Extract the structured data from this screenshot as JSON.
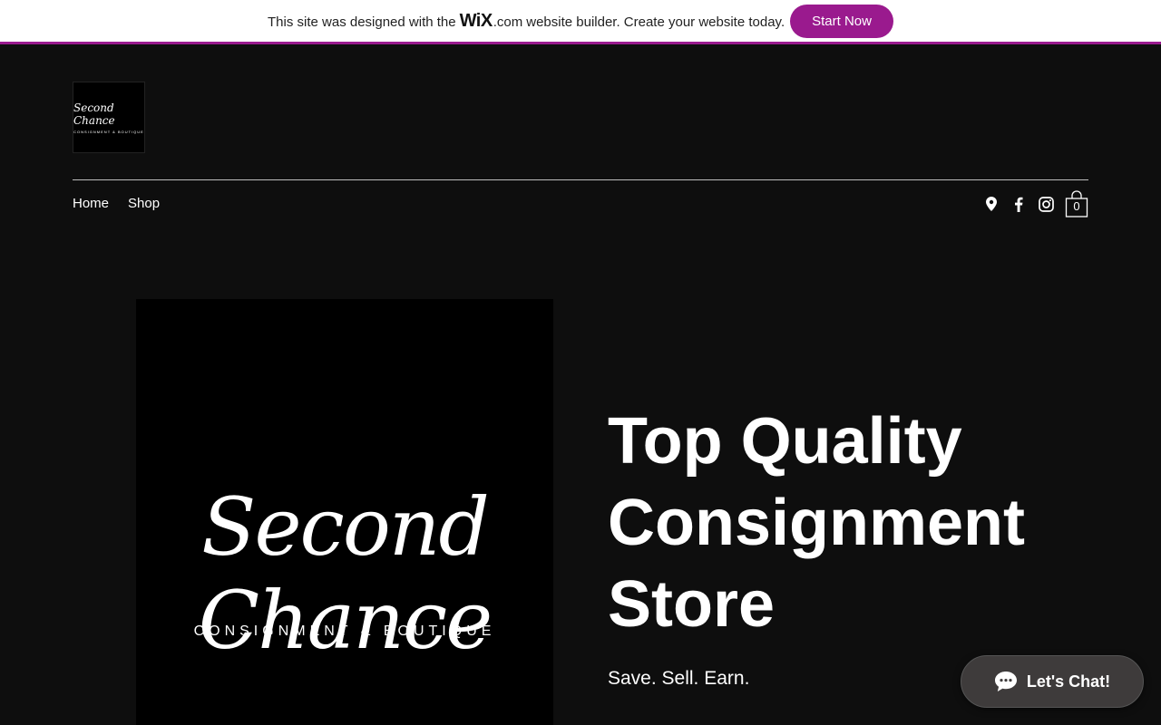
{
  "banner": {
    "text_before": "This site was designed with the",
    "brand": "WiX",
    "text_after": ".com",
    "text_tail": "website builder. Create your website today.",
    "cta": "Start Now"
  },
  "header": {
    "logo_script": "Second Chance",
    "logo_sub": "CONSIGNMENT & BOUTIQUE",
    "nav": [
      {
        "label": "Home"
      },
      {
        "label": "Shop"
      }
    ],
    "social_icons": [
      "location-pin-icon",
      "facebook-icon",
      "instagram-icon"
    ],
    "cart_count": "0"
  },
  "hero": {
    "image_script": "Second Chance",
    "image_tagline": "CONSIGNMENT & BOUTIQUE",
    "headline": "Top Quality Consignment Store",
    "subline": "Save. Sell. Earn."
  },
  "chat": {
    "label": "Let's Chat!"
  },
  "colors": {
    "accent": "#9a1a8e",
    "background": "#0e0e0e",
    "chat_bg": "#3e3b3b"
  }
}
